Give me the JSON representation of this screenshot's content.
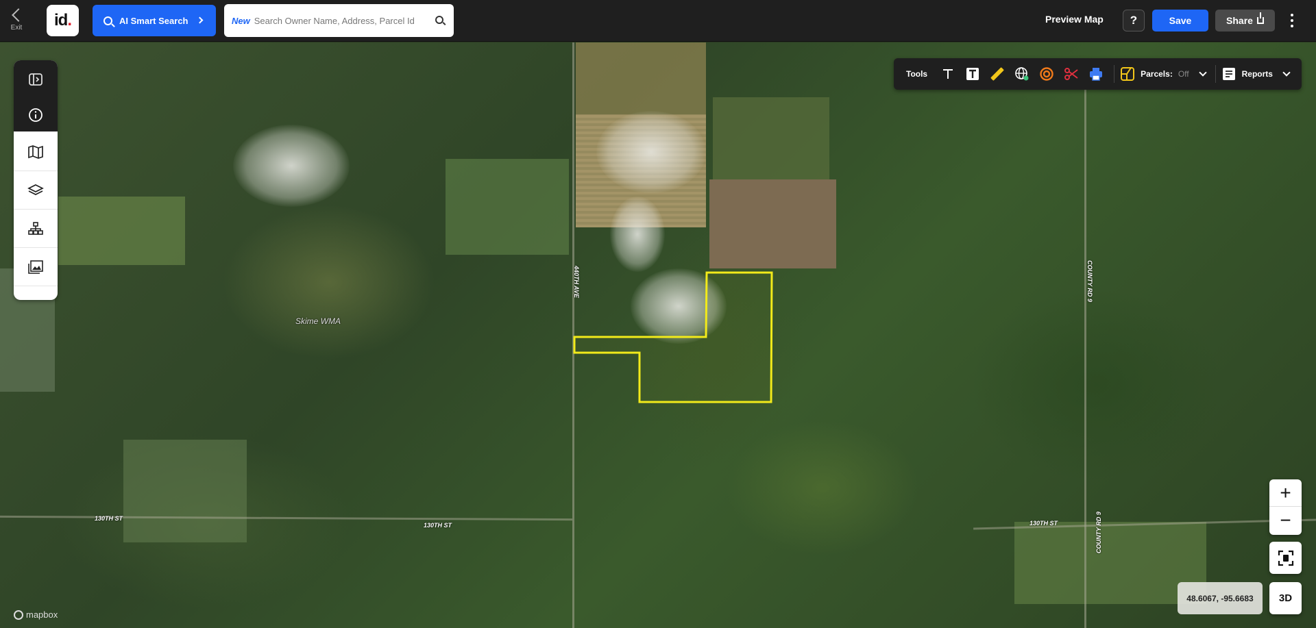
{
  "app": {
    "exit_label": "Exit",
    "logo_text": "id",
    "ai_search_label": "AI Smart Search",
    "search": {
      "badge": "New",
      "placeholder": "Search Owner Name, Address, Parcel Id"
    },
    "preview_label": "Preview Map",
    "help_label": "?",
    "save_label": "Save",
    "share_label": "Share"
  },
  "sidebar": {
    "items": [
      {
        "icon": "panel-toggle-icon"
      },
      {
        "icon": "info-icon"
      },
      {
        "icon": "map-icon"
      },
      {
        "icon": "layers-icon"
      },
      {
        "icon": "org-chart-icon"
      },
      {
        "icon": "image-gallery-icon"
      }
    ]
  },
  "tools": {
    "label": "Tools",
    "items": [
      {
        "icon": "text-icon"
      },
      {
        "icon": "text-box-icon"
      },
      {
        "icon": "ruler-icon"
      },
      {
        "icon": "globe-icon"
      },
      {
        "icon": "radius-icon"
      },
      {
        "icon": "scissors-icon"
      },
      {
        "icon": "print-icon"
      }
    ],
    "parcels_label": "Parcels:",
    "parcels_state": "Off",
    "reports_label": "Reports"
  },
  "map": {
    "labels": {
      "road_440th": "440TH AVE",
      "road_county_9a": "COUNTY RD 9",
      "road_county_9b": "COUNTY RD 9",
      "road_130th_a": "130TH ST",
      "road_130th_b": "130TH ST",
      "road_130th_c": "130TH ST",
      "wma": "Skime WMA"
    },
    "attribution": "mapbox",
    "boundary_color": "#f2ea1a"
  },
  "controls": {
    "zoom_in": "+",
    "zoom_out": "−",
    "coordinates": "48.6067, -95.6683",
    "btn_3d": "3D"
  }
}
